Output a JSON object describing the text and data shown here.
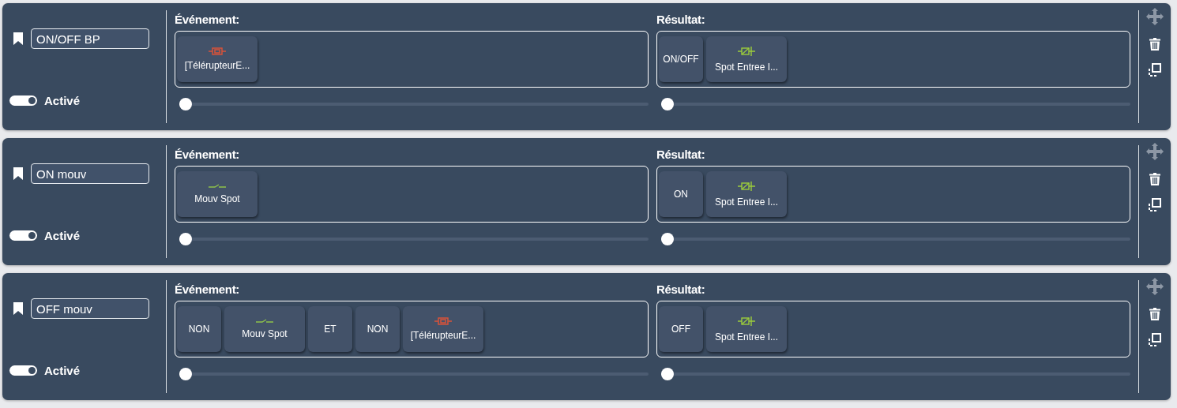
{
  "rules": [
    {
      "name": "ON/OFF BP",
      "active": true,
      "active_label": "Activé",
      "event": {
        "title": "Événement:",
        "level": 0,
        "blocks": [
          {
            "kind": "relay",
            "label": "[TélérupteurE..."
          }
        ]
      },
      "result": {
        "title": "Résultat:",
        "level": 0,
        "blocks": [
          {
            "kind": "operator",
            "label": "ON/OFF"
          },
          {
            "kind": "lamp",
            "label": "Spot Entree I..."
          }
        ]
      }
    },
    {
      "name": "ON mouv",
      "active": true,
      "active_label": "Activé",
      "event": {
        "title": "Événement:",
        "level": 0,
        "blocks": [
          {
            "kind": "motion",
            "label": "Mouv Spot"
          }
        ]
      },
      "result": {
        "title": "Résultat:",
        "level": 0,
        "blocks": [
          {
            "kind": "operator",
            "label": "ON"
          },
          {
            "kind": "lamp",
            "label": "Spot Entree I..."
          }
        ]
      }
    },
    {
      "name": "OFF mouv",
      "active": true,
      "active_label": "Activé",
      "event": {
        "title": "Événement:",
        "level": 0,
        "blocks": [
          {
            "kind": "operator",
            "label": "NON"
          },
          {
            "kind": "motion",
            "label": "Mouv Spot"
          },
          {
            "kind": "operator",
            "label": "ET"
          },
          {
            "kind": "operator",
            "label": "NON"
          },
          {
            "kind": "relay",
            "label": "[TélérupteurE..."
          }
        ]
      },
      "result": {
        "title": "Résultat:",
        "level": 0,
        "blocks": [
          {
            "kind": "operator",
            "label": "OFF"
          },
          {
            "kind": "lamp",
            "label": "Spot Entree I..."
          }
        ]
      }
    }
  ]
}
